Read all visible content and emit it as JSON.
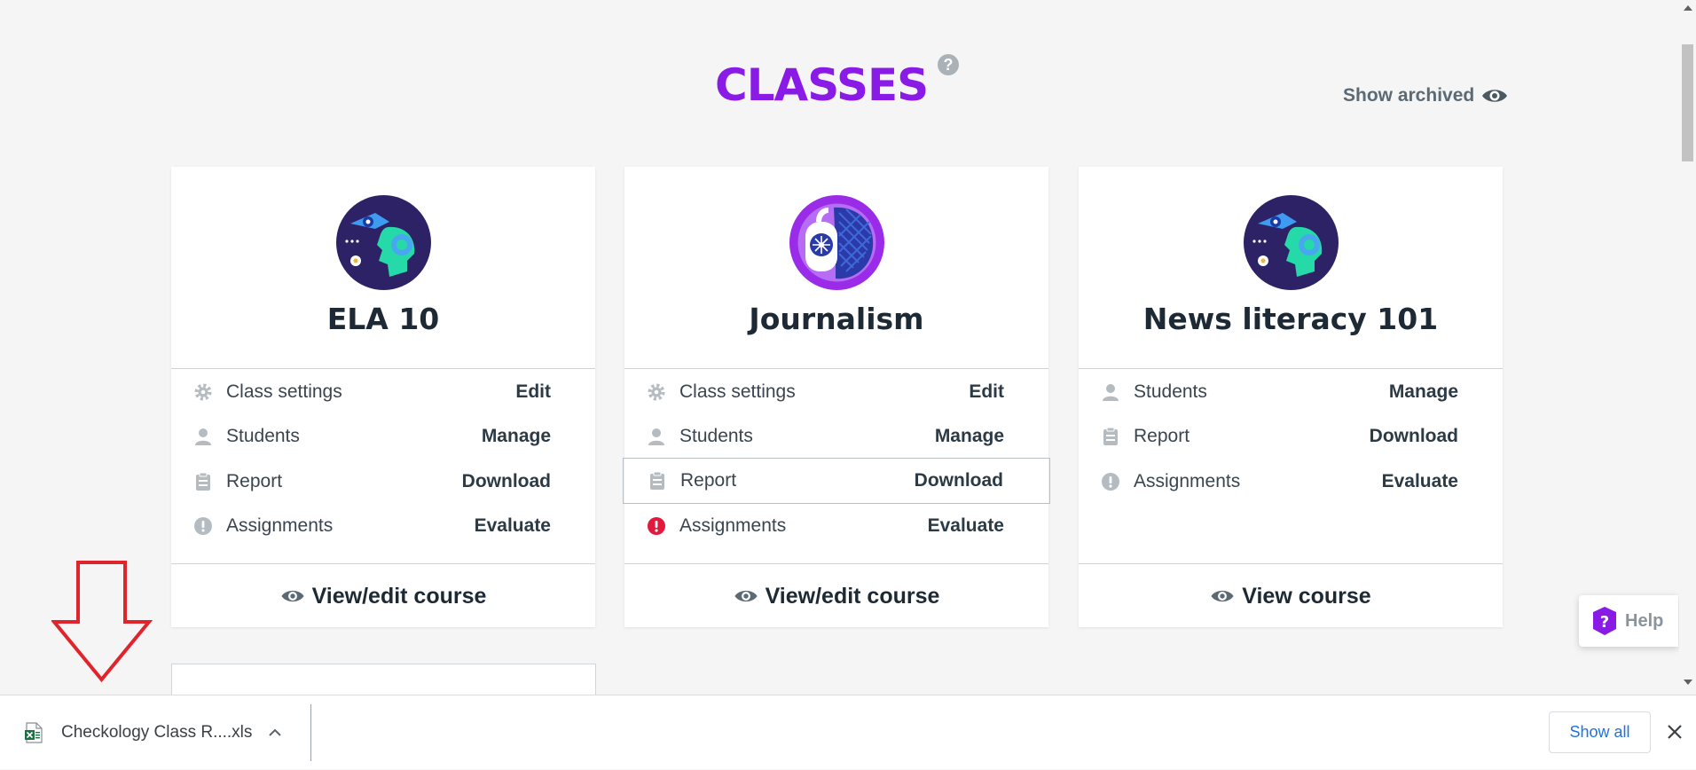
{
  "header": {
    "title": "CLASSES",
    "help_icon_glyph": "?",
    "show_archived_label": "Show archived"
  },
  "cards": [
    {
      "title": "ELA 10",
      "logo_icon": "head-eye-flower-logo",
      "rows": [
        {
          "icon": "gear-icon",
          "label": "Class settings",
          "action": "Edit"
        },
        {
          "icon": "person-icon",
          "label": "Students",
          "action": "Manage"
        },
        {
          "icon": "clipboard-icon",
          "label": "Report",
          "action": "Download"
        },
        {
          "icon": "alert-icon",
          "label": "Assignments",
          "action": "Evaluate"
        }
      ],
      "footer_label": "View/edit course"
    },
    {
      "title": "Journalism",
      "logo_icon": "journalism-logo",
      "rows": [
        {
          "icon": "gear-icon",
          "label": "Class settings",
          "action": "Edit"
        },
        {
          "icon": "person-icon",
          "label": "Students",
          "action": "Manage"
        },
        {
          "icon": "clipboard-icon",
          "label": "Report",
          "action": "Download"
        },
        {
          "icon": "alert-red-icon",
          "label": "Assignments",
          "action": "Evaluate"
        }
      ],
      "footer_label": "View/edit course"
    },
    {
      "title": "News literacy 101",
      "logo_icon": "head-eye-flower-logo",
      "rows": [
        {
          "icon": "person-icon",
          "label": "Students",
          "action": "Manage"
        },
        {
          "icon": "clipboard-icon",
          "label": "Report",
          "action": "Download"
        },
        {
          "icon": "alert-icon",
          "label": "Assignments",
          "action": "Evaluate"
        }
      ],
      "footer_label": "View course"
    }
  ],
  "help_widget": {
    "glyph": "?",
    "label": "Help"
  },
  "download_bar": {
    "file_name": "Checkology Class R....xls",
    "show_all_label": "Show all"
  },
  "colors": {
    "brand_purple": "#8a1be6",
    "alert_red": "#e0193d",
    "annotation_red": "#e0242b",
    "link_blue": "#1a73e8"
  }
}
